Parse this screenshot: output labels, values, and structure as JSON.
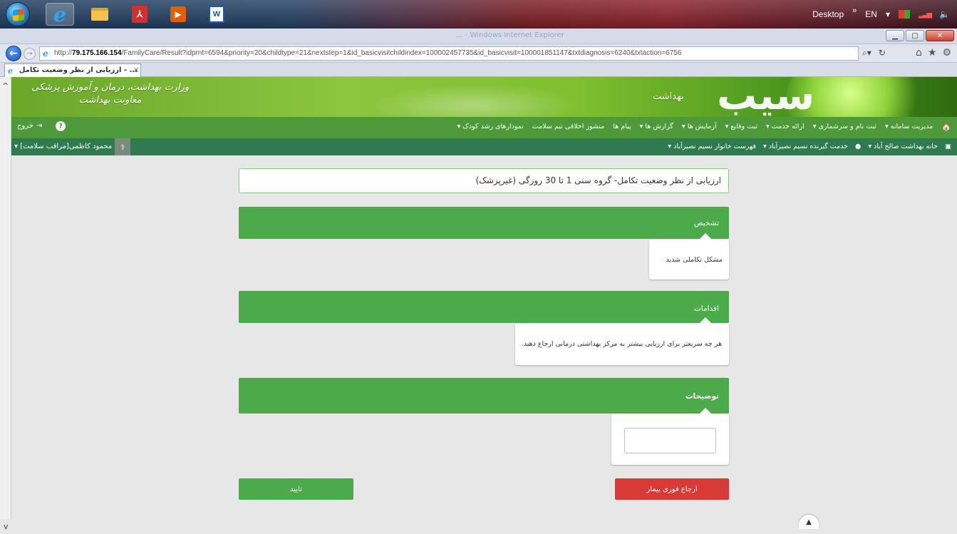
{
  "taskbar": {
    "desktop_label": "Desktop",
    "desktop_chevron": "»",
    "language": "EN",
    "language_dropdown": "▾"
  },
  "browser": {
    "url_prefix": "http://",
    "url_host": "79.175.166.154",
    "url_rest": "/FamilyCare/Result?idprnt=6594&priority=20&childtype=21&nextstep=1&id_basicvisitchildindex=100002457735&id_basicvisit=100001851147&txtdiagnosis=6240&txtaction=6756",
    "tab_title": "... - ارزیابی از نظر وضعیت تکامل",
    "tab_close": "×",
    "title_blur": "... - Windows Internet Explorer"
  },
  "banner": {
    "ministry_line1": "وزارت بهداشت، درمان و آموزش پزشکی",
    "ministry_line2": "معاونت بهداشت",
    "logo_text": "بهداشت"
  },
  "nav1": {
    "items": [
      "مدیریت سامانه ▾",
      "ثبت نام و سرشماری ▾",
      "ارائه خدمت ▾",
      "ثبت وقایع ▾",
      "آزمایش ها ▾",
      "گزارش ها ▾",
      "پیام ها",
      "منشور اخلاقی تیم سلامت",
      "نمودارهای رشد کودک ▾"
    ],
    "exit_label": "خروج",
    "help_label": "?"
  },
  "nav2": {
    "items": [
      "خانه بهداشت صالح آباد ▾",
      "خدمت گیرنده نسیم نصیرآباد ▾",
      "فهرست خانوار نسیم نصیرآباد ▾"
    ],
    "user_label": "محمود کاظمی[مراقب سلامت] ▾"
  },
  "page": {
    "header": "ارزیابی از نظر وضعیت تکامل- گروه سنی 1 تا 30 روزگی (غیرپزشک)",
    "diagnosis_title": "تشخیص",
    "diagnosis_value": "مشکل تکاملی شدید",
    "actions_title": "اقدامات",
    "actions_value": "هر چه سریعتر برای ارزیابی بیشتر به مرکز بهداشتی درمانی ارجاع دهید.",
    "comments_title": "توضیحات",
    "comments_value": "",
    "confirm_button": "تایید",
    "refer_button": "ارجاع فوری بیمار"
  }
}
